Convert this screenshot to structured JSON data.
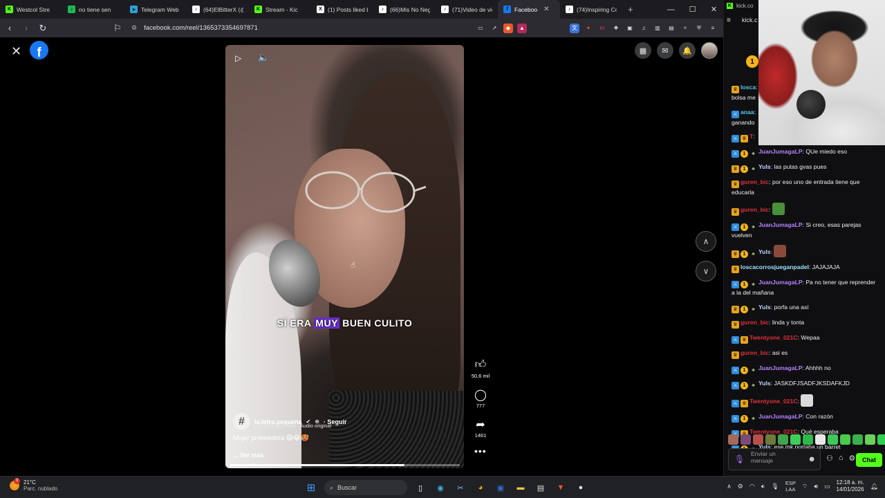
{
  "browser": {
    "tabs": [
      {
        "title": "Westcol Stre",
        "fav_color": "#53fc18",
        "fav_glyph": "K",
        "icon": "kick-icon"
      },
      {
        "title": "no tiene sen",
        "fav_color": "#1db954",
        "fav_glyph": "♪",
        "icon": "spotify-icon"
      },
      {
        "title": "Telegram Web",
        "fav_color": "#2aa1da",
        "fav_glyph": "➤",
        "icon": "telegram-icon"
      },
      {
        "title": "(64)ElBitterX (@",
        "fav_color": "#ffffff",
        "fav_glyph": "♪",
        "icon": "tiktok-icon"
      },
      {
        "title": "Stream - Kic",
        "fav_color": "#53fc18",
        "fav_glyph": "K",
        "icon": "kick-icon"
      },
      {
        "title": "(1) Posts liked b",
        "fav_color": "#ffffff",
        "fav_glyph": "X",
        "icon": "x-icon"
      },
      {
        "title": "(66)Mis No Neg",
        "fav_color": "#ffffff",
        "fav_glyph": "♪",
        "icon": "tiktok-icon"
      },
      {
        "title": "(71)Video de vic",
        "fav_color": "#ffffff",
        "fav_glyph": "♪",
        "icon": "tiktok-icon"
      },
      {
        "title": "Faceboo",
        "fav_color": "#1877f2",
        "fav_glyph": "f",
        "icon": "facebook-icon",
        "active": true
      },
      {
        "title": "(74)Inspiring Co",
        "fav_color": "#ffffff",
        "fav_glyph": "♪",
        "icon": "tiktok-icon"
      }
    ],
    "new_tab": "+",
    "url": "facebook.com/reel/1365373354697871"
  },
  "reel": {
    "subtitle_before": "SÍ ERA ",
    "subtitle_highlight": "MUY",
    "subtitle_after": " BUEN CULITO",
    "author": "la.letra.pequena",
    "author_avatar": "#",
    "follow": "· Seguir",
    "audio": "la.letra.pequena · Audio original",
    "caption": "Mujer proveedora 😱😂🥵",
    "see_more": "... Ver más",
    "progress_fraction": 0.76,
    "likes": "50,6 mil",
    "comments": "777",
    "shares": "1461"
  },
  "chat": {
    "url": "kick.co",
    "tab": "kick.c",
    "rank": "1",
    "messages": [
      {
        "badges": [
          "crown"
        ],
        "user": "losca",
        "color": "#53c8f0",
        "text": "",
        "cont": "bolsa me"
      },
      {
        "badges": [
          "blue"
        ],
        "user": "anaa",
        "color": "#53c8f0",
        "text": "",
        "cont": "ganando"
      },
      {
        "badges": [
          "blue",
          "crown"
        ],
        "user": "T",
        "color": "#e0303a",
        "text": ""
      },
      {
        "badges": [
          "blue",
          "coin",
          "plant"
        ],
        "user": "JuanJumagaLP",
        "color": "#b583ff",
        "text": "QUe miedo eso"
      },
      {
        "badges": [
          "crown",
          "coin",
          "plant"
        ],
        "user": "Yuls",
        "color": "#b8d6ff",
        "text": "las putas gvas pues"
      },
      {
        "badges": [
          "crown"
        ],
        "user": "guren_bic",
        "color": "#e0303a",
        "text": "por eso uno de entrada tiene que educarla"
      },
      {
        "badges": [
          "crown"
        ],
        "user": "guren_bic",
        "color": "#e0303a",
        "text": "",
        "emote": "#4a8f3a"
      },
      {
        "badges": [
          "blue",
          "coin",
          "plant"
        ],
        "user": "JuanJumagaLP",
        "color": "#b583ff",
        "text": "Si creo, esas parejas vuelven"
      },
      {
        "badges": [
          "crown",
          "coin",
          "plant"
        ],
        "user": "Yuls",
        "color": "#b8d6ff",
        "text": "",
        "emote": "#8a4a3a"
      },
      {
        "badges": [
          "crown"
        ],
        "user": "loscacorrosjueganpadel",
        "color": "#9fe3ff",
        "text": "JAJAJAJA"
      },
      {
        "badges": [
          "blue",
          "coin",
          "plant"
        ],
        "user": "JuanJumagaLP",
        "color": "#b583ff",
        "text": "Pa no tener que reprender a la del mañana"
      },
      {
        "badges": [
          "crown",
          "coin",
          "plant"
        ],
        "user": "Yuls",
        "color": "#b8d6ff",
        "text": "porfa una así"
      },
      {
        "badges": [
          "crown"
        ],
        "user": "guren_bic",
        "color": "#e0303a",
        "text": "linda y tonta"
      },
      {
        "badges": [
          "blue",
          "crown"
        ],
        "user": "Twentyone_021C",
        "color": "#e0303a",
        "text": "Wepaa"
      },
      {
        "badges": [
          "crown"
        ],
        "user": "guren_bic",
        "color": "#e0303a",
        "text": "asi es"
      },
      {
        "badges": [
          "blue",
          "coin",
          "plant"
        ],
        "user": "JuanJumagaLP",
        "color": "#b583ff",
        "text": "Ahhhh no"
      },
      {
        "badges": [
          "blue",
          "coin",
          "plant"
        ],
        "user": "Yuls",
        "color": "#b8d6ff",
        "text": "JASKDFJSADFJKSDAFKJD"
      },
      {
        "badges": [
          "blue",
          "crown"
        ],
        "user": "Twentyone_021C",
        "color": "#e0303a",
        "text": "",
        "emote": "#d9d9d9"
      },
      {
        "badges": [
          "blue",
          "coin",
          "plant"
        ],
        "user": "JuanJumagaLP",
        "color": "#b583ff",
        "text": "Con razón"
      },
      {
        "badges": [
          "blue",
          "crown"
        ],
        "user": "Twentyone_021C",
        "color": "#e0303a",
        "text": "Qué esperaba"
      },
      {
        "badges": [
          "blue",
          "coin",
          "plant"
        ],
        "user": "Yuls",
        "color": "#b8d6ff",
        "text": "ese mk portaba un barret"
      }
    ],
    "emote_colors": [
      "#a56a5a",
      "#7a4a7a",
      "#b5504a",
      "#6e7a3a",
      "#3fa64a",
      "#3ecf5a",
      "#2fb84a",
      "#e8e8e8",
      "#3dc85a",
      "#4acb4a",
      "#3ab04a",
      "#6ad15a",
      "#2fd04f"
    ],
    "input_placeholder": "Enviar un mensaje",
    "send_label": "Chat"
  },
  "taskbar": {
    "temp": "21°C",
    "weather": "Parc. nublado",
    "weather_badge": "3",
    "search": "Buscar",
    "lang1": "ESP",
    "lang2": "LAA",
    "time": "12:18 a. m.",
    "date": "14/01/2026"
  }
}
